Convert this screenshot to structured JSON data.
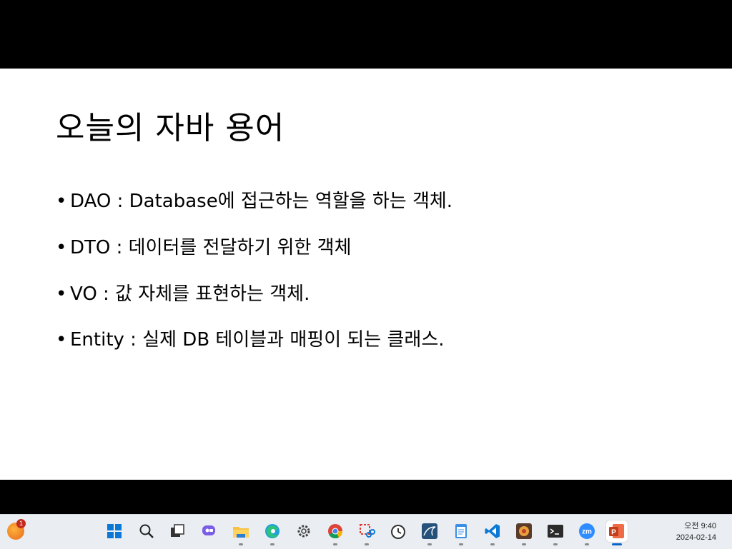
{
  "slide": {
    "title": "오늘의 자바 용어",
    "bullets": [
      {
        "marker": "•",
        "text": "DAO :  Database에 접근하는 역할을 하는 객체."
      },
      {
        "marker": "•",
        "text": "DTO : 데이터를 전달하기 위한 객체"
      },
      {
        "marker": "•",
        "text": "VO : 값 자체를 표현하는 객체."
      },
      {
        "marker": "•",
        "text": "Entity : 실제 DB 테이블과 매핑이 되는 클래스."
      }
    ]
  },
  "taskbar": {
    "weather_badge": "1",
    "clock_time": "오전 9:40",
    "clock_date": "2024-02-14",
    "icons": [
      "windows-start-icon",
      "search-icon",
      "task-view-icon",
      "chat-icon",
      "file-explorer-icon",
      "edge-icon",
      "settings-icon",
      "chrome-icon",
      "snipping-tool-icon",
      "clock-app-icon",
      "mysql-workbench-icon",
      "notepad-icon",
      "vscode-icon",
      "game-app-icon",
      "terminal-icon",
      "zoom-icon",
      "powerpoint-icon"
    ],
    "accent_color": "#0a64c8"
  }
}
